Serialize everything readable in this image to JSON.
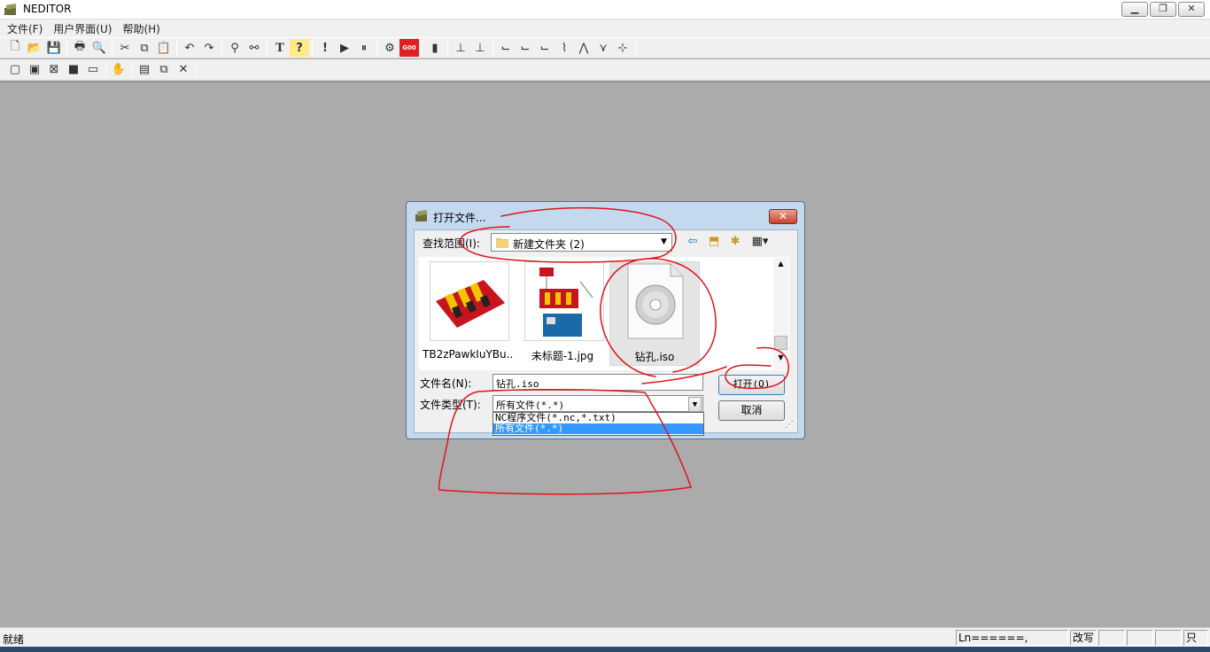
{
  "window": {
    "title": "NEDITOR",
    "minimize": "▁",
    "maximize": "❐",
    "close": "✕"
  },
  "menu": [
    "文件(F)",
    "用户界面(U)",
    "帮助(H)"
  ],
  "toolbar1": [
    "new-file",
    "open-folder",
    "save",
    "print",
    "print-preview",
    "cut",
    "copy",
    "paste",
    "undo",
    "redo",
    "find",
    "find-replace",
    "text",
    "help",
    "alert",
    "run",
    "pause",
    "simulate",
    "g00",
    "tool",
    "axis-1",
    "axis-2",
    "path-1",
    "path-2",
    "path-3",
    "path-4",
    "path-5",
    "path-6",
    "path-7"
  ],
  "toolbar2": [
    "view-1",
    "view-2",
    "view-3",
    "view-4",
    "view-5",
    "hand",
    "properties",
    "copy-window",
    "close-x"
  ],
  "status": {
    "text": "就绪",
    "position": "Ln======, Col===",
    "mode": "改写",
    "readonly": "只读"
  },
  "dialog": {
    "title": "打开文件...",
    "close": "✕",
    "look_in_label": "查找范围(I):",
    "look_in_value": "新建文件夹 (2)",
    "files": [
      {
        "name": "TB2zPawkIuYBu...",
        "kind": "image-red-board"
      },
      {
        "name": "未标题-1.jpg",
        "kind": "image-wiring"
      },
      {
        "name": "钻孔.iso",
        "kind": "disc-image"
      }
    ],
    "file_name_label": "文件名(N):",
    "file_name_value": "钻孔.iso",
    "file_type_label": "文件类型(T):",
    "file_type_value": "所有文件(*.*)",
    "file_type_options": [
      "NC程序文件(*.nc,*.txt)",
      "所有文件(*.*)"
    ],
    "open_button": "打开(O)",
    "cancel_button": "取消"
  },
  "colors": {
    "annotation": "#e0141e",
    "dialog_frame": "#c4d9ee",
    "selected_option": "#3399ff",
    "workspace": "#ababab"
  }
}
